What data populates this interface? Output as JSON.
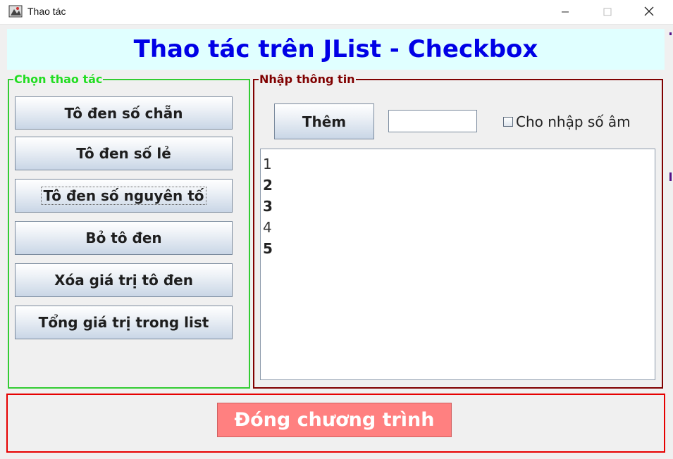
{
  "window": {
    "title": "Thao tác",
    "icons": [
      "app-icon",
      "minimize-icon",
      "maximize-icon",
      "close-icon"
    ]
  },
  "header": {
    "title": "Thao tác trên JList - Checkbox"
  },
  "left_panel": {
    "legend": "Chọn thao tác",
    "buttons": [
      {
        "label": "Tô đen số chẵn"
      },
      {
        "label": "Tô đen số lẻ"
      },
      {
        "label": "Tô đen số nguyên tố"
      },
      {
        "label": "Bỏ tô đen"
      },
      {
        "label": "Xóa giá trị tô đen"
      },
      {
        "label": "Tổng giá trị trong list"
      }
    ]
  },
  "right_panel": {
    "legend": "Nhập thông tin",
    "add_label": "Thêm",
    "input_value": "",
    "checkbox_label": "Cho nhập số âm",
    "checkbox_checked": false,
    "list_items": [
      {
        "text": "1",
        "bold": false
      },
      {
        "text": "2",
        "bold": true
      },
      {
        "text": "3",
        "bold": true
      },
      {
        "text": "4",
        "bold": false
      },
      {
        "text": "5",
        "bold": true
      }
    ]
  },
  "footer": {
    "close_label": "Đóng chương trình"
  },
  "colors": {
    "header_bg": "#e0ffff",
    "header_text": "#0000e6",
    "left_border": "#33cc33",
    "right_border": "#800000",
    "bottom_border": "#e60000",
    "close_button_bg": "#ff8080"
  }
}
